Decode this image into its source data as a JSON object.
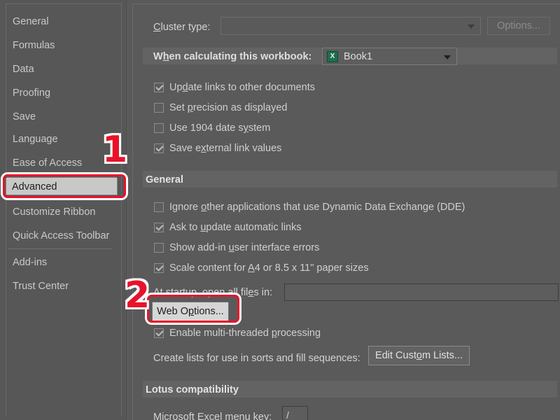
{
  "sidebar": {
    "items": [
      {
        "label": "General",
        "selected": false
      },
      {
        "label": "Formulas",
        "selected": false
      },
      {
        "label": "Data",
        "selected": false
      },
      {
        "label": "Proofing",
        "selected": false
      },
      {
        "label": "Save",
        "selected": false
      },
      {
        "label": "Language",
        "selected": false
      },
      {
        "label": "Ease of Access",
        "selected": false
      },
      {
        "label": "Advanced",
        "selected": true
      },
      {
        "label": "Customize Ribbon",
        "selected": false
      },
      {
        "label": "Quick Access Toolbar",
        "selected": false
      },
      {
        "label": "Add-ins",
        "selected": false
      },
      {
        "label": "Trust Center",
        "selected": false
      }
    ]
  },
  "main": {
    "cluster_type": {
      "label": "Cluster type:",
      "label_accel": "C",
      "value": "",
      "options_button": "Options...",
      "options_enabled": false
    },
    "when_calculating": {
      "label": "When calculating this workbook:",
      "label_accel": "h",
      "workbook_value": "Book1",
      "workbook_icon": "excel-icon",
      "checkboxes": [
        {
          "label": "Update links to other documents",
          "accel": "d",
          "checked": true
        },
        {
          "label": "Set precision as displayed",
          "accel": "p",
          "checked": false
        },
        {
          "label": "Use 1904 date system",
          "accel": "y",
          "checked": false
        },
        {
          "label": "Save external link values",
          "accel": "x",
          "checked": true
        }
      ]
    },
    "general_section": {
      "title": "General",
      "checkboxes": [
        {
          "label": "Ignore other applications that use Dynamic Data Exchange (DDE)",
          "accel": "o",
          "checked": false
        },
        {
          "label": "Ask to update automatic links",
          "accel": "u",
          "checked": true
        },
        {
          "label": "Show add-in user interface errors",
          "accel": "u",
          "checked": false
        },
        {
          "label": "Scale content for A4 or 8.5 x 11\" paper sizes",
          "accel": "A",
          "checked": true
        }
      ],
      "startup_label": "At startup, open all files in:",
      "startup_accel": "e",
      "startup_value": "",
      "web_options_button": "Web Options...",
      "web_options_accel": "p",
      "multithread_checkbox": {
        "label": "Enable multi-threaded processing",
        "accel": "p",
        "checked": true
      },
      "create_lists_label": "Create lists for use in sorts and fill sequences:",
      "edit_custom_lists_button": "Edit Custom Lists...",
      "edit_custom_lists_accel": "o"
    },
    "lotus_section": {
      "title": "Lotus compatibility",
      "menu_key_label": "Microsoft Excel menu key:",
      "menu_key_accel": "m",
      "menu_key_value": "/"
    }
  },
  "annotations": {
    "markers": [
      {
        "label": "1",
        "target": "Advanced"
      },
      {
        "label": "2",
        "target": "Web Options..."
      }
    ],
    "highlight_color": "#e8122a"
  }
}
